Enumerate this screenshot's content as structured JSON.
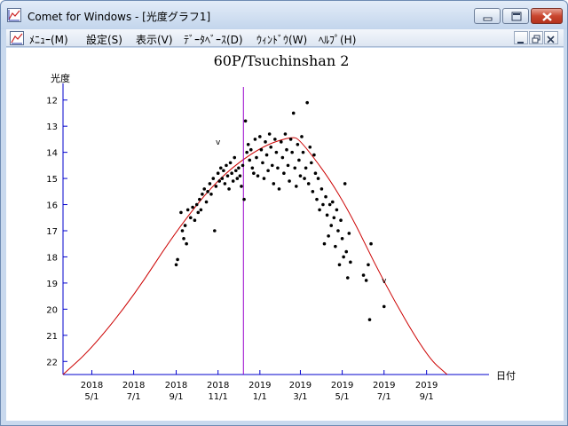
{
  "window": {
    "title": "Comet for Windows - [光度グラフ1]"
  },
  "menu": {
    "items": [
      "ﾒﾆｭｰ(M)",
      "設定(S)",
      "表示(V)",
      "ﾃﾞｰﾀﾍﾞｰｽ(D)",
      "ｳｨﾝﾄﾞｳ(W)",
      "ﾍﾙﾌﾟ(H)"
    ]
  },
  "icons": {
    "app": "graph-app-icon",
    "minimize": "minimize-icon",
    "maximize": "maximize-icon",
    "close": "close-icon",
    "mdi_minimize": "mdi-minimize-icon",
    "mdi_restore": "mdi-restore-icon",
    "mdi_close": "mdi-close-icon"
  },
  "colors": {
    "curve": "#cc0000",
    "axis": "#0000cc",
    "marker_line": "#9900cc",
    "points": "#000000"
  },
  "chart_data": {
    "type": "scatter",
    "title": "60P/Tsuchinshan 2",
    "ylabel": "光度",
    "xlabel": "日付",
    "ylim": [
      22.5,
      11.5
    ],
    "xlim": [
      "2018-03-20",
      "2019-12-01"
    ],
    "y_ticks": [
      "12",
      "13",
      "14",
      "15",
      "16",
      "17",
      "18",
      "19",
      "20",
      "21",
      "22"
    ],
    "x_ticks": [
      {
        "date": "2018-05-01",
        "year": "2018",
        "day": "5/1"
      },
      {
        "date": "2018-07-01",
        "year": "2018",
        "day": "7/1"
      },
      {
        "date": "2018-09-01",
        "year": "2018",
        "day": "9/1"
      },
      {
        "date": "2018-11-01",
        "year": "2018",
        "day": "11/1"
      },
      {
        "date": "2019-01-01",
        "year": "2019",
        "day": "1/1"
      },
      {
        "date": "2019-03-01",
        "year": "2019",
        "day": "3/1"
      },
      {
        "date": "2019-05-01",
        "year": "2019",
        "day": "5/1"
      },
      {
        "date": "2019-07-01",
        "year": "2019",
        "day": "7/1"
      },
      {
        "date": "2019-09-01",
        "year": "2019",
        "day": "9/1"
      }
    ],
    "current_date_marker": "2018-12-08",
    "annotations": [
      {
        "text": "v",
        "date": "2018-11-01",
        "mag": 13.7
      },
      {
        "text": "v",
        "date": "2019-07-01",
        "mag": 19.0
      }
    ],
    "model_curve": {
      "peak_date": "2019-02-15",
      "peak_mag": 13.4,
      "points": [
        [
          "2018-03-20",
          22.5
        ],
        [
          "2018-05-01",
          21.5
        ],
        [
          "2018-07-01",
          19.5
        ],
        [
          "2018-09-01",
          17.0
        ],
        [
          "2018-11-01",
          15.0
        ],
        [
          "2019-01-01",
          13.8
        ],
        [
          "2019-02-15",
          13.4
        ],
        [
          "2019-03-01",
          13.5
        ],
        [
          "2019-05-01",
          15.7
        ],
        [
          "2019-07-01",
          19.0
        ],
        [
          "2019-09-01",
          21.8
        ],
        [
          "2019-10-01",
          22.5
        ]
      ]
    },
    "points": [
      [
        "2018-09-01",
        18.3
      ],
      [
        "2018-09-03",
        18.1
      ],
      [
        "2018-09-08",
        16.3
      ],
      [
        "2018-09-10",
        17.0
      ],
      [
        "2018-09-12",
        17.3
      ],
      [
        "2018-09-14",
        16.8
      ],
      [
        "2018-09-16",
        17.5
      ],
      [
        "2018-09-18",
        16.2
      ],
      [
        "2018-09-22",
        16.5
      ],
      [
        "2018-09-25",
        16.1
      ],
      [
        "2018-09-28",
        16.6
      ],
      [
        "2018-10-01",
        16.0
      ],
      [
        "2018-10-03",
        16.3
      ],
      [
        "2018-10-05",
        15.8
      ],
      [
        "2018-10-07",
        16.2
      ],
      [
        "2018-10-09",
        15.6
      ],
      [
        "2018-10-12",
        15.4
      ],
      [
        "2018-10-15",
        15.9
      ],
      [
        "2018-10-17",
        15.5
      ],
      [
        "2018-10-20",
        15.2
      ],
      [
        "2018-10-22",
        15.6
      ],
      [
        "2018-10-25",
        15.0
      ],
      [
        "2018-10-27",
        17.0
      ],
      [
        "2018-10-29",
        15.3
      ],
      [
        "2018-11-01",
        14.8
      ],
      [
        "2018-11-03",
        15.1
      ],
      [
        "2018-11-05",
        14.6
      ],
      [
        "2018-11-07",
        15.0
      ],
      [
        "2018-11-09",
        14.7
      ],
      [
        "2018-11-11",
        15.2
      ],
      [
        "2018-11-13",
        14.5
      ],
      [
        "2018-11-15",
        14.9
      ],
      [
        "2018-11-17",
        15.4
      ],
      [
        "2018-11-19",
        14.4
      ],
      [
        "2018-11-21",
        14.8
      ],
      [
        "2018-11-23",
        15.1
      ],
      [
        "2018-11-25",
        14.2
      ],
      [
        "2018-11-27",
        14.7
      ],
      [
        "2018-11-29",
        15.0
      ],
      [
        "2018-12-01",
        14.6
      ],
      [
        "2018-12-03",
        14.9
      ],
      [
        "2018-12-05",
        15.3
      ],
      [
        "2018-12-07",
        14.5
      ],
      [
        "2018-12-09",
        15.8
      ],
      [
        "2018-12-11",
        12.8
      ],
      [
        "2018-12-13",
        14.0
      ],
      [
        "2018-12-15",
        13.7
      ],
      [
        "2018-12-17",
        14.3
      ],
      [
        "2018-12-19",
        13.9
      ],
      [
        "2018-12-21",
        14.6
      ],
      [
        "2018-12-23",
        14.8
      ],
      [
        "2018-12-25",
        13.5
      ],
      [
        "2018-12-27",
        14.2
      ],
      [
        "2018-12-29",
        14.9
      ],
      [
        "2019-01-01",
        13.4
      ],
      [
        "2019-01-03",
        13.9
      ],
      [
        "2019-01-05",
        14.4
      ],
      [
        "2019-01-07",
        15.0
      ],
      [
        "2019-01-09",
        13.6
      ],
      [
        "2019-01-11",
        14.1
      ],
      [
        "2019-01-13",
        14.7
      ],
      [
        "2019-01-15",
        13.3
      ],
      [
        "2019-01-17",
        13.8
      ],
      [
        "2019-01-19",
        14.5
      ],
      [
        "2019-01-21",
        15.2
      ],
      [
        "2019-01-23",
        13.5
      ],
      [
        "2019-01-25",
        14.0
      ],
      [
        "2019-01-27",
        14.6
      ],
      [
        "2019-01-29",
        15.4
      ],
      [
        "2019-02-01",
        13.6
      ],
      [
        "2019-02-03",
        14.2
      ],
      [
        "2019-02-05",
        14.8
      ],
      [
        "2019-02-07",
        13.3
      ],
      [
        "2019-02-09",
        13.9
      ],
      [
        "2019-02-11",
        14.5
      ],
      [
        "2019-02-13",
        15.1
      ],
      [
        "2019-02-15",
        13.5
      ],
      [
        "2019-02-17",
        14.0
      ],
      [
        "2019-02-19",
        12.5
      ],
      [
        "2019-02-21",
        14.6
      ],
      [
        "2019-02-23",
        15.3
      ],
      [
        "2019-02-25",
        13.7
      ],
      [
        "2019-02-27",
        14.3
      ],
      [
        "2019-03-01",
        14.9
      ],
      [
        "2019-03-03",
        13.4
      ],
      [
        "2019-03-05",
        14.0
      ],
      [
        "2019-03-07",
        15.0
      ],
      [
        "2019-03-09",
        14.6
      ],
      [
        "2019-03-11",
        12.1
      ],
      [
        "2019-03-13",
        15.2
      ],
      [
        "2019-03-15",
        13.8
      ],
      [
        "2019-03-17",
        14.4
      ],
      [
        "2019-03-19",
        15.5
      ],
      [
        "2019-03-21",
        14.1
      ],
      [
        "2019-03-23",
        14.8
      ],
      [
        "2019-03-25",
        15.8
      ],
      [
        "2019-03-27",
        15.0
      ],
      [
        "2019-03-29",
        16.2
      ],
      [
        "2019-04-01",
        15.4
      ],
      [
        "2019-04-03",
        16.0
      ],
      [
        "2019-04-05",
        17.5
      ],
      [
        "2019-04-07",
        15.7
      ],
      [
        "2019-04-09",
        16.4
      ],
      [
        "2019-04-11",
        17.2
      ],
      [
        "2019-04-13",
        16.0
      ],
      [
        "2019-04-15",
        16.8
      ],
      [
        "2019-04-17",
        15.9
      ],
      [
        "2019-04-19",
        16.5
      ],
      [
        "2019-04-21",
        17.6
      ],
      [
        "2019-04-23",
        16.2
      ],
      [
        "2019-04-25",
        17.0
      ],
      [
        "2019-04-27",
        18.3
      ],
      [
        "2019-04-29",
        16.6
      ],
      [
        "2019-05-01",
        17.3
      ],
      [
        "2019-05-03",
        18.0
      ],
      [
        "2019-05-05",
        15.2
      ],
      [
        "2019-05-07",
        17.8
      ],
      [
        "2019-05-09",
        18.8
      ],
      [
        "2019-05-11",
        17.1
      ],
      [
        "2019-05-13",
        18.2
      ],
      [
        "2019-06-01",
        18.7
      ],
      [
        "2019-06-05",
        18.9
      ],
      [
        "2019-06-08",
        18.3
      ],
      [
        "2019-06-10",
        20.4
      ],
      [
        "2019-06-12",
        17.5
      ],
      [
        "2019-07-01",
        19.9
      ]
    ]
  }
}
